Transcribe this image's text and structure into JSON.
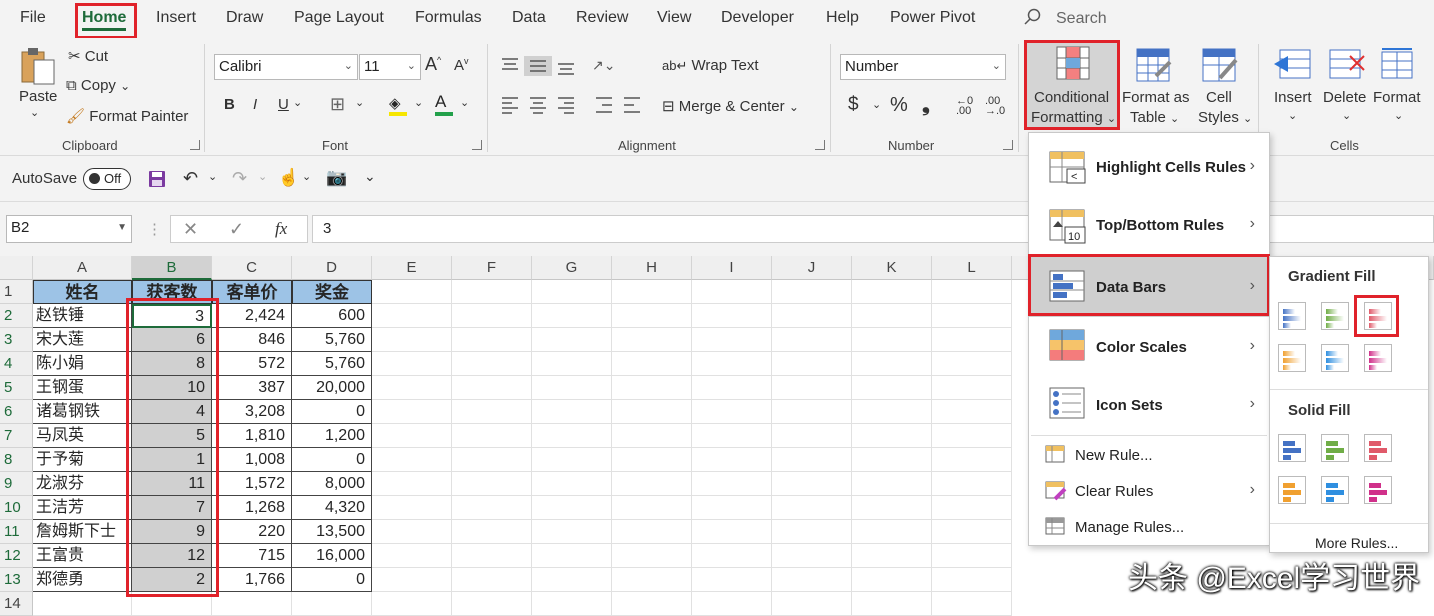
{
  "menu": {
    "tabs": [
      "File",
      "Home",
      "Insert",
      "Draw",
      "Page Layout",
      "Formulas",
      "Data",
      "Review",
      "View",
      "Developer",
      "Help",
      "Power Pivot"
    ],
    "search": "Search"
  },
  "ribbon": {
    "clipboard": {
      "paste": "Paste",
      "cut": "Cut",
      "copy": "Copy",
      "format_painter": "Format Painter",
      "label": "Clipboard"
    },
    "font": {
      "name": "Calibri",
      "size": "11",
      "label": "Font",
      "bold": "B",
      "italic": "I",
      "underline": "U"
    },
    "alignment": {
      "wrap_text": "Wrap Text",
      "merge_center": "Merge & Center",
      "label": "Alignment"
    },
    "number": {
      "format": "Number",
      "currency": "$",
      "percent": "%",
      "comma": "❟",
      "label": "Number"
    },
    "styles": {
      "conditional_formatting_1": "Conditional",
      "conditional_formatting_2": "Formatting",
      "format_as_1": "Format as",
      "format_as_2": "Table",
      "cell_styles_1": "Cell",
      "cell_styles_2": "Styles"
    },
    "cells": {
      "insert": "Insert",
      "delete": "Delete",
      "format": "Format",
      "label": "Cells"
    }
  },
  "qat": {
    "autosave": "AutoSave",
    "toggle": "Off"
  },
  "formula_bar": {
    "name_box": "B2",
    "fx": "fx",
    "value": "3"
  },
  "columns": [
    "A",
    "B",
    "C",
    "D",
    "E",
    "F",
    "G",
    "H",
    "I",
    "J",
    "K",
    "L"
  ],
  "rows": [
    "1",
    "2",
    "3",
    "4",
    "5",
    "6",
    "7",
    "8",
    "9",
    "10",
    "11",
    "12",
    "13",
    "14"
  ],
  "table": {
    "headers": [
      "姓名",
      "获客数",
      "客单价",
      "奖金"
    ],
    "data": [
      [
        "赵铁锤",
        "3",
        "2,424",
        "600"
      ],
      [
        "宋大莲",
        "6",
        "846",
        "5,760"
      ],
      [
        "陈小娟",
        "8",
        "572",
        "5,760"
      ],
      [
        "王钢蛋",
        "10",
        "387",
        "20,000"
      ],
      [
        "诸葛钢铁",
        "4",
        "3,208",
        "0"
      ],
      [
        "马凤英",
        "5",
        "1,810",
        "1,200"
      ],
      [
        "于予菊",
        "1",
        "1,008",
        "0"
      ],
      [
        "龙淑芬",
        "11",
        "1,572",
        "8,000"
      ],
      [
        "王洁芳",
        "7",
        "1,268",
        "4,320"
      ],
      [
        "詹姆斯下士",
        "9",
        "220",
        "13,500"
      ],
      [
        "王富贵",
        "12",
        "715",
        "16,000"
      ],
      [
        "郑德勇",
        "2",
        "1,766",
        "0"
      ]
    ]
  },
  "cf_menu": {
    "items": [
      "Highlight Cells Rules",
      "Top/Bottom Rules",
      "Data Bars",
      "Color Scales",
      "Icon Sets"
    ],
    "actions": [
      "New Rule...",
      "Clear Rules",
      "Manage Rules..."
    ]
  },
  "submenu": {
    "gradient": "Gradient Fill",
    "solid": "Solid Fill",
    "more": "More Rules..."
  },
  "bar_colors": [
    "#4472c4",
    "#70ad47",
    "#e05a6a",
    "#f0a030",
    "#2f8fe0",
    "#d0308a"
  ],
  "watermark": "头条 @Excel学习世界"
}
